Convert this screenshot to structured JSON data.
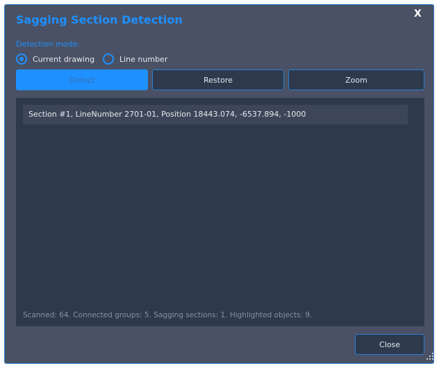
{
  "dialog": {
    "title": "Sagging Section Detection",
    "close_glyph": "X"
  },
  "detection_mode": {
    "label": "Detection mode:",
    "options": [
      {
        "label": "Current drawing",
        "checked": true
      },
      {
        "label": "Line number",
        "checked": false
      }
    ]
  },
  "toolbar": {
    "detect_label": "Detect",
    "restore_label": "Restore",
    "zoom_label": "Zoom"
  },
  "results": {
    "items": [
      "Section #1, LineNumber 2701-01, Position 18443.074, -6537.894, -1000"
    ],
    "status": "Scanned: 64. Connected groups: 5. Sagging sections: 1. Highlighted objects: 9."
  },
  "footer": {
    "close_label": "Close"
  },
  "colors": {
    "accent": "#1e90ff",
    "dialog_bg": "#4a5164",
    "panel_bg": "#2e3a4b",
    "item_bg": "#3c4658"
  }
}
